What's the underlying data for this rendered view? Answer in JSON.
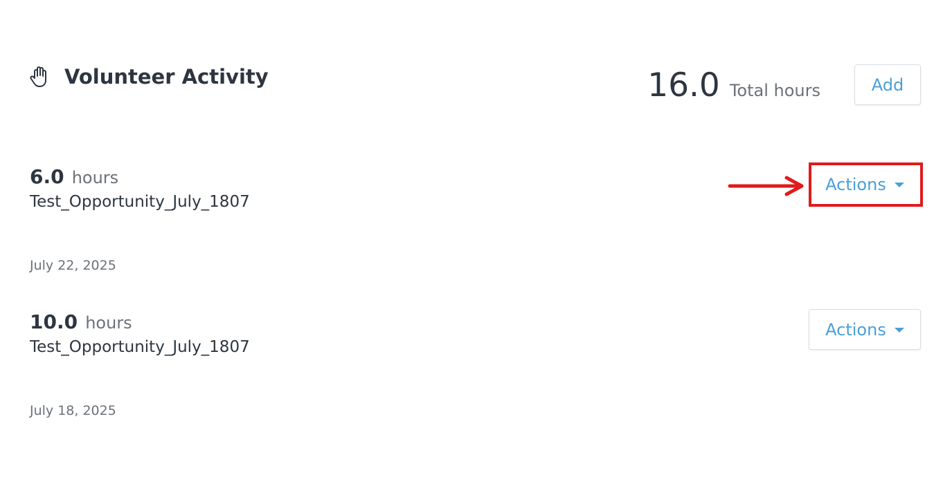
{
  "header": {
    "title": "Volunteer Activity",
    "icon": "hand-icon",
    "total_value": "16.0",
    "total_label": "Total hours",
    "add_label": "Add"
  },
  "entries": [
    {
      "hours": "6.0",
      "hours_unit": "hours",
      "name": "Test_Opportunity_July_1807",
      "actions_label": "Actions",
      "date": "July 22, 2025",
      "highlighted": true
    },
    {
      "hours": "10.0",
      "hours_unit": "hours",
      "name": "Test_Opportunity_July_1807",
      "actions_label": "Actions",
      "date": "July 18, 2025",
      "highlighted": false
    }
  ],
  "annotation": {
    "highlight_color": "#e01b1b"
  },
  "colors": {
    "accent": "#4a9fd8",
    "text": "#2d3640",
    "muted": "#6b7178"
  }
}
